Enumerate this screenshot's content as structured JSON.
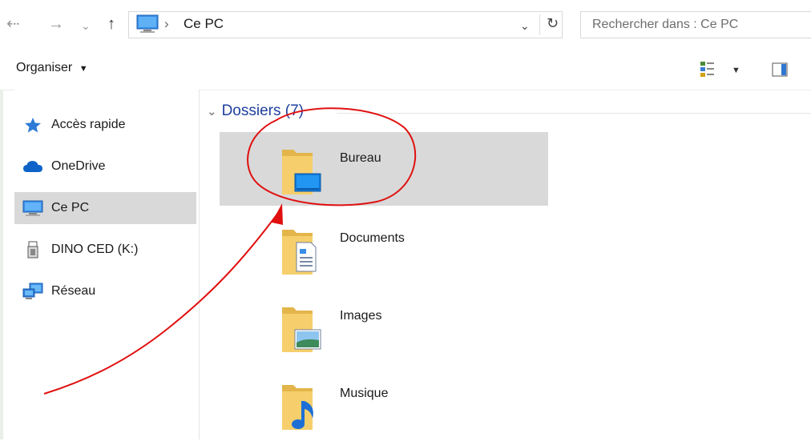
{
  "address_bar": {
    "breadcrumb_separator": "›",
    "location": "Ce PC",
    "search_placeholder": "Rechercher dans : Ce PC"
  },
  "command_bar": {
    "organiser_label": "Organiser"
  },
  "sidebar": {
    "items": [
      {
        "label": "Accès rapide",
        "icon": "star-icon",
        "selected": false
      },
      {
        "label": "OneDrive",
        "icon": "cloud-icon",
        "selected": false
      },
      {
        "label": "Ce PC",
        "icon": "monitor-icon",
        "selected": true
      },
      {
        "label": "DINO CED (K:)",
        "icon": "usb-drive-icon",
        "selected": false
      },
      {
        "label": "Réseau",
        "icon": "network-icon",
        "selected": false
      }
    ]
  },
  "content": {
    "group_label": "Dossiers (7)",
    "folders": [
      {
        "label": "Bureau",
        "icon": "desktop-folder-icon",
        "selected": true
      },
      {
        "label": "Documents",
        "icon": "documents-folder-icon",
        "selected": false
      },
      {
        "label": "Images",
        "icon": "pictures-folder-icon",
        "selected": false
      },
      {
        "label": "Musique",
        "icon": "music-folder-icon",
        "selected": false
      }
    ]
  },
  "annotation": {
    "color": "#e01010"
  }
}
